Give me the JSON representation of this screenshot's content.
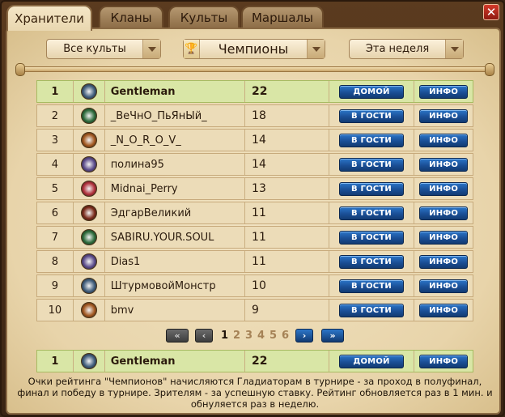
{
  "tabs": [
    "Хранители",
    "Кланы",
    "Культы",
    "Маршалы"
  ],
  "active_tab": 0,
  "close_label": "✕",
  "filters": {
    "cult": "Все культы",
    "category": "Чемпионы",
    "period": "Эта неделя"
  },
  "rows": [
    {
      "rank": "1",
      "name": "Gentleman",
      "score": "22",
      "action": "ДОМОЙ",
      "info": "ИНФО",
      "cult_icon": "white-cult-icon",
      "cult_color": "#3f5c7a"
    },
    {
      "rank": "2",
      "name": "_ВеЧнО_ПьЯнЫй_",
      "score": "18",
      "action": "В ГОСТИ",
      "info": "ИНФО",
      "cult_icon": "green-cult-icon",
      "cult_color": "#2c6a3a"
    },
    {
      "rank": "3",
      "name": "_N_O_R_O_V_",
      "score": "14",
      "action": "В ГОСТИ",
      "info": "ИНФО",
      "cult_icon": "orange-cult-icon",
      "cult_color": "#a0561e"
    },
    {
      "rank": "4",
      "name": "полина95",
      "score": "14",
      "action": "В ГОСТИ",
      "info": "ИНФО",
      "cult_icon": "purple-cult-icon",
      "cult_color": "#5a4a8a"
    },
    {
      "rank": "5",
      "name": "Midnai_Perry",
      "score": "13",
      "action": "В ГОСТИ",
      "info": "ИНФО",
      "cult_icon": "red-cult-icon",
      "cult_color": "#b0303a"
    },
    {
      "rank": "6",
      "name": "ЭдгарВеликий",
      "score": "11",
      "action": "В ГОСТИ",
      "info": "ИНФО",
      "cult_icon": "skull-cult-icon",
      "cult_color": "#7a2a1a"
    },
    {
      "rank": "7",
      "name": "SABIRU.YOUR.SOUL",
      "score": "11",
      "action": "В ГОСТИ",
      "info": "ИНФО",
      "cult_icon": "green-cult-icon",
      "cult_color": "#2c6a3a"
    },
    {
      "rank": "8",
      "name": "Dias1",
      "score": "11",
      "action": "В ГОСТИ",
      "info": "ИНФО",
      "cult_icon": "purple-cult-icon",
      "cult_color": "#5a4a8a"
    },
    {
      "rank": "9",
      "name": "ШтурмовойМонстр",
      "score": "10",
      "action": "В ГОСТИ",
      "info": "ИНФО",
      "cult_icon": "white-cult-icon",
      "cult_color": "#3f5c7a"
    },
    {
      "rank": "10",
      "name": "bmv",
      "score": "9",
      "action": "В ГОСТИ",
      "info": "ИНФО",
      "cult_icon": "orange-cult-icon",
      "cult_color": "#a0561e"
    }
  ],
  "pagination": {
    "first": "«",
    "prev": "‹",
    "pages": [
      "1",
      "2",
      "3",
      "4",
      "5",
      "6"
    ],
    "current": "1",
    "next": "›",
    "last": "»"
  },
  "own_row": {
    "rank": "1",
    "name": "Gentleman",
    "score": "22",
    "action": "ДОМОЙ",
    "info": "ИНФО",
    "cult_icon": "white-cult-icon",
    "cult_color": "#3f5c7a"
  },
  "footer_note": "Очки рейтинга \"Чемпионов\" начисляются Гладиаторам в турнире - за проход в полуфинал, финал и победу в турнире. Зрителям - за успешную ставку. Рейтинг обновляется раз в 1 мин. и обнуляется раз в неделю."
}
